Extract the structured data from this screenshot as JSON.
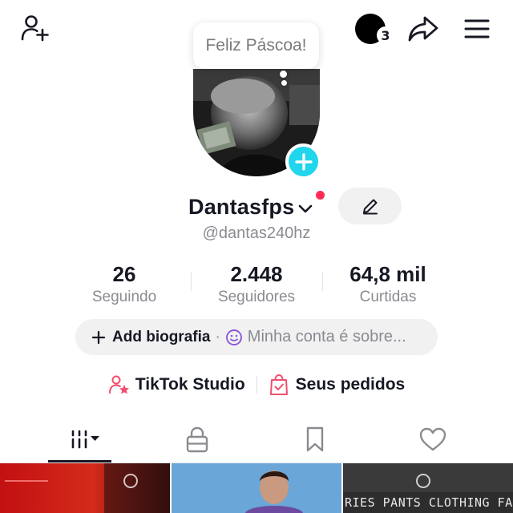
{
  "header": {
    "add_user_icon": "person-plus-icon",
    "story_count": "3",
    "share_icon": "share-arrow-icon",
    "menu_icon": "hamburger-menu-icon"
  },
  "tooltip": {
    "text": "Feliz Páscoa!"
  },
  "profile": {
    "username": "Dantasfps",
    "handle": "@dantas240hz",
    "add_photo_icon": "plus-icon"
  },
  "stats": [
    {
      "value": "26",
      "label": "Seguindo"
    },
    {
      "value": "2.448",
      "label": "Seguidores"
    },
    {
      "value": "64,8 mil",
      "label": "Curtidas"
    }
  ],
  "bio": {
    "add_label": "Add biografia",
    "separator": "·",
    "placeholder": "Minha conta é sobre..."
  },
  "links": {
    "studio": "TikTok Studio",
    "orders": "Seus pedidos"
  },
  "tabs": [
    {
      "name": "videos",
      "icon": "grid-bars-icon",
      "active": true
    },
    {
      "name": "private",
      "icon": "lock-icon",
      "active": false
    },
    {
      "name": "saved",
      "icon": "bookmark-icon",
      "active": false
    },
    {
      "name": "liked",
      "icon": "heart-icon",
      "active": false
    }
  ],
  "thumbnails": {
    "third_caption": "RIES PANTS CLOTHING FASH"
  },
  "colors": {
    "accent_cyan": "#20d5ec",
    "accent_red": "#fe2c55",
    "text_primary": "#161823",
    "text_secondary": "#8a8b91",
    "pill_bg": "#f1f1f2"
  }
}
